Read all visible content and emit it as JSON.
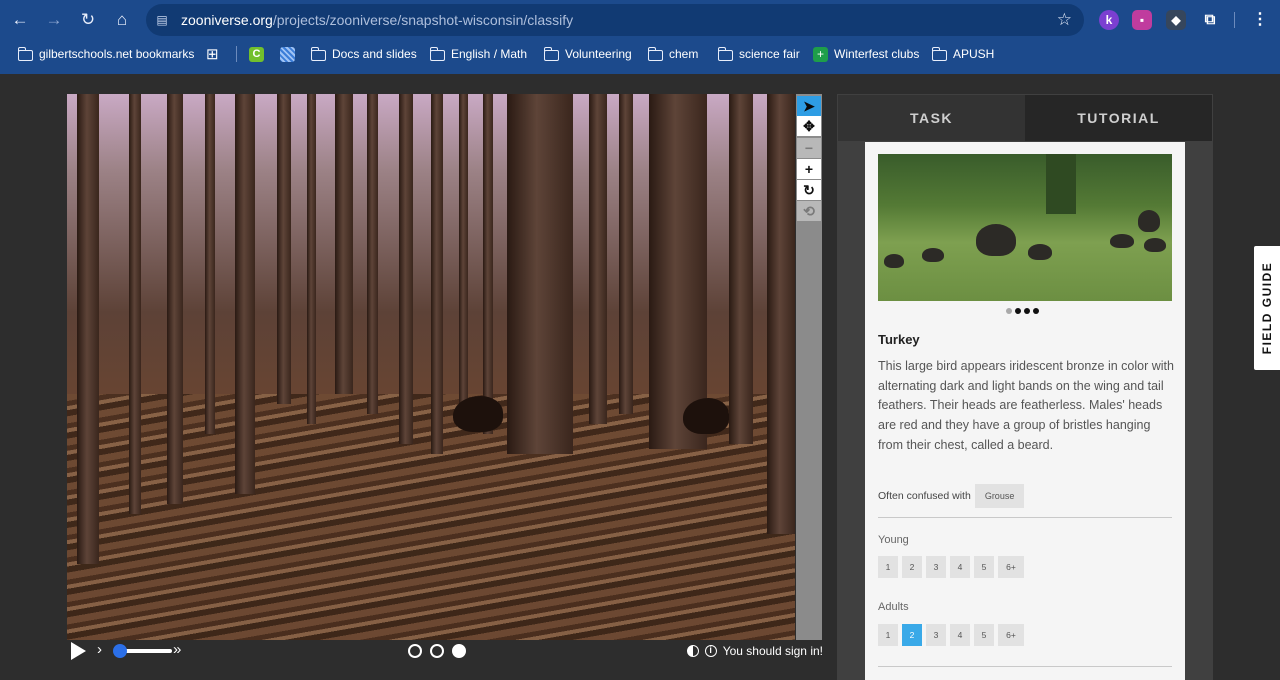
{
  "browser": {
    "url_host": "zooniverse.org",
    "url_path": "/projects/zooniverse/snapshot-wisconsin/classify",
    "bookmarks": [
      {
        "label": "gilbertschools.net bookmarks"
      },
      {
        "label": "Docs and slides"
      },
      {
        "label": "English / Math"
      },
      {
        "label": "Volunteering"
      },
      {
        "label": "chem"
      },
      {
        "label": "science fair"
      },
      {
        "label": "Winterfest clubs"
      },
      {
        "label": "APUSH"
      }
    ],
    "ext_icons": [
      "k-extension-icon",
      "record-extension-icon",
      "shield-extension-icon",
      "puzzle-icon"
    ]
  },
  "viewer": {
    "status_text": "You should sign in!",
    "frames": 3,
    "current_frame": 3
  },
  "panel": {
    "tabs": [
      "TASK",
      "TUTORIAL"
    ],
    "species_name": "Turkey",
    "description": "This large bird appears iridescent bronze in color with alternating dark and light bands on the wing and tail feathers. Their heads are featherless. Males' heads are red and they have a group of bristles hanging from their chest, called a beard.",
    "confused_label": "Often confused with",
    "confused_with": "Grouse",
    "young_label": "Young",
    "adults_label": "Adults",
    "counts": [
      "1",
      "2",
      "3",
      "4",
      "5",
      "6+"
    ],
    "adults_selected": "2"
  },
  "field_guide_label": "FIELD GUIDE",
  "colors": {
    "chrome_blue": "#1c4a8c",
    "accent_blue": "#39a9e8",
    "tool_active": "#2e9de4"
  }
}
